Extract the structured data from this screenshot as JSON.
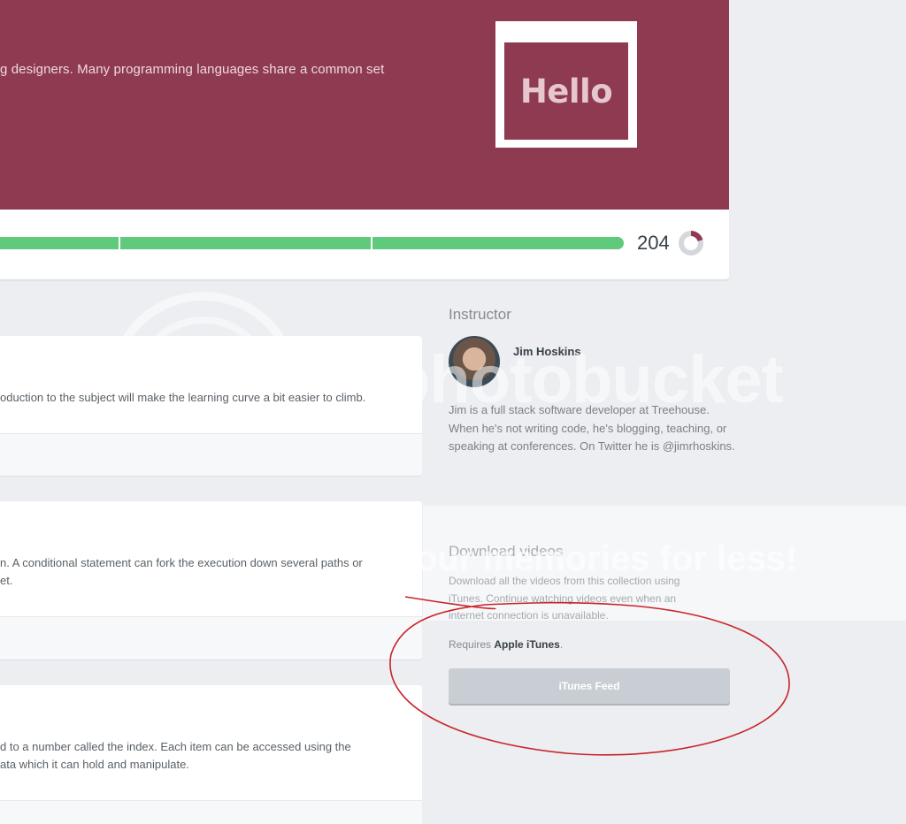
{
  "hero": {
    "description": "g designers. Many programming languages share a common set",
    "badge_text": "Hello",
    "points": "204",
    "colors": {
      "banner": "#8e3a50",
      "progress": "#5fca7b"
    }
  },
  "stages": [
    {
      "lines": [
        "oduction to the subject will make the learning curve a bit easier to climb."
      ]
    },
    {
      "lines": [
        "n. A conditional statement can fork the execution down several paths or",
        "et."
      ]
    },
    {
      "lines": [
        "d to a number called the index. Each item can be accessed using the",
        "ata which it can hold and manipulate."
      ]
    }
  ],
  "sidebar": {
    "instructor_heading": "Instructor",
    "instructor_name": "Jim Hoskins",
    "bio": "Jim is a full stack software developer at Treehouse. When he's not writing code, he's blogging, teaching, or speaking at conferences. On Twitter he is @jimrhoskins.",
    "download_heading": "Download videos",
    "download_desc": "Download all the videos from this collection using iTunes. Continue watching videos even when an internet connection is unavailable.",
    "requires_prefix": "Requires",
    "requires_link": "Apple iTunes",
    "requires_suffix": ".",
    "itunes_button": "iTunes Feed"
  },
  "watermark": {
    "text": "photobucket",
    "tagline": "our memories for less!"
  }
}
